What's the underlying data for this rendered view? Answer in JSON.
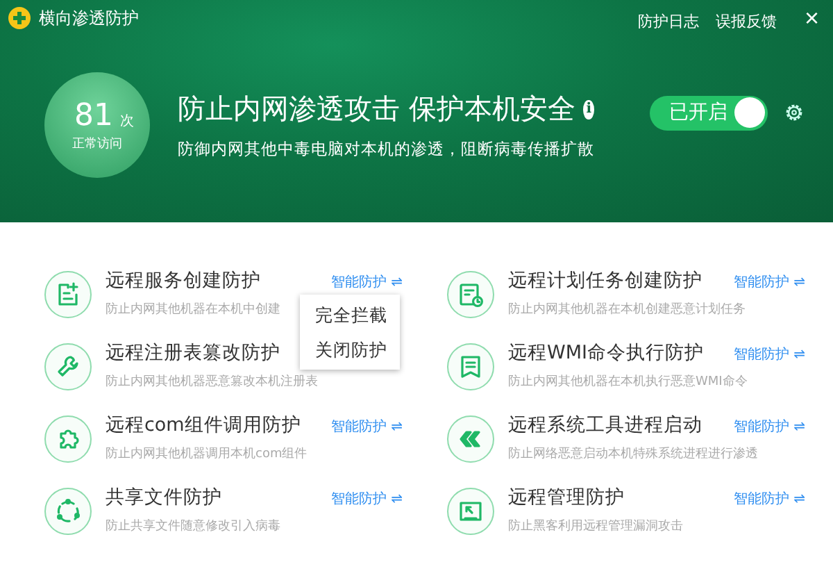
{
  "window": {
    "title": "横向渗透防护",
    "links": [
      "防护日志",
      "误报反馈"
    ],
    "close": "×"
  },
  "summary": {
    "count": "81",
    "unit": "次",
    "count_label": "正常访问",
    "headline": "防止内网渗透攻击 保护本机安全",
    "info": "i",
    "subtitle": "防御内网其他中毒电脑对本机的渗透，阻断病毒传播扩散",
    "switch": {
      "label": "已开启",
      "on": true
    }
  },
  "protections": [
    {
      "title": "远程服务创建防护",
      "description": "防止内网其他机器在本机中创建",
      "mode": "智能防护 ⇌"
    },
    {
      "title": "远程计划任务创建防护",
      "description": "防止内网其他机器在本机创建恶意计划任务",
      "mode": "智能防护 ⇌"
    },
    {
      "title": "远程注册表篡改防护",
      "description": "防止内网其他机器恶意篡改本机注册表"
    },
    {
      "title": "远程WMI命令执行防护",
      "description": "防止内网其他机器在本机执行恶意WMI命令",
      "mode": "智能防护 ⇌"
    },
    {
      "title": "远程com组件调用防护",
      "description": "防止内网其他机器调用本机com组件",
      "mode": "智能防护 ⇌"
    },
    {
      "title": "远程系统工具进程启动",
      "description": "防止网络恶意启动本机特殊系统进程进行渗透",
      "mode": "智能防护 ⇌"
    },
    {
      "title": "共享文件防护",
      "description": "防止共享文件随意修改引入病毒",
      "mode": "智能防护 ⇌"
    },
    {
      "title": "远程管理防护",
      "description": "防止黑客利用远程管理漏洞攻击",
      "mode": "智能防护 ⇌"
    }
  ],
  "mode_menu": {
    "items": [
      "完全拦截",
      "关闭防护"
    ]
  }
}
